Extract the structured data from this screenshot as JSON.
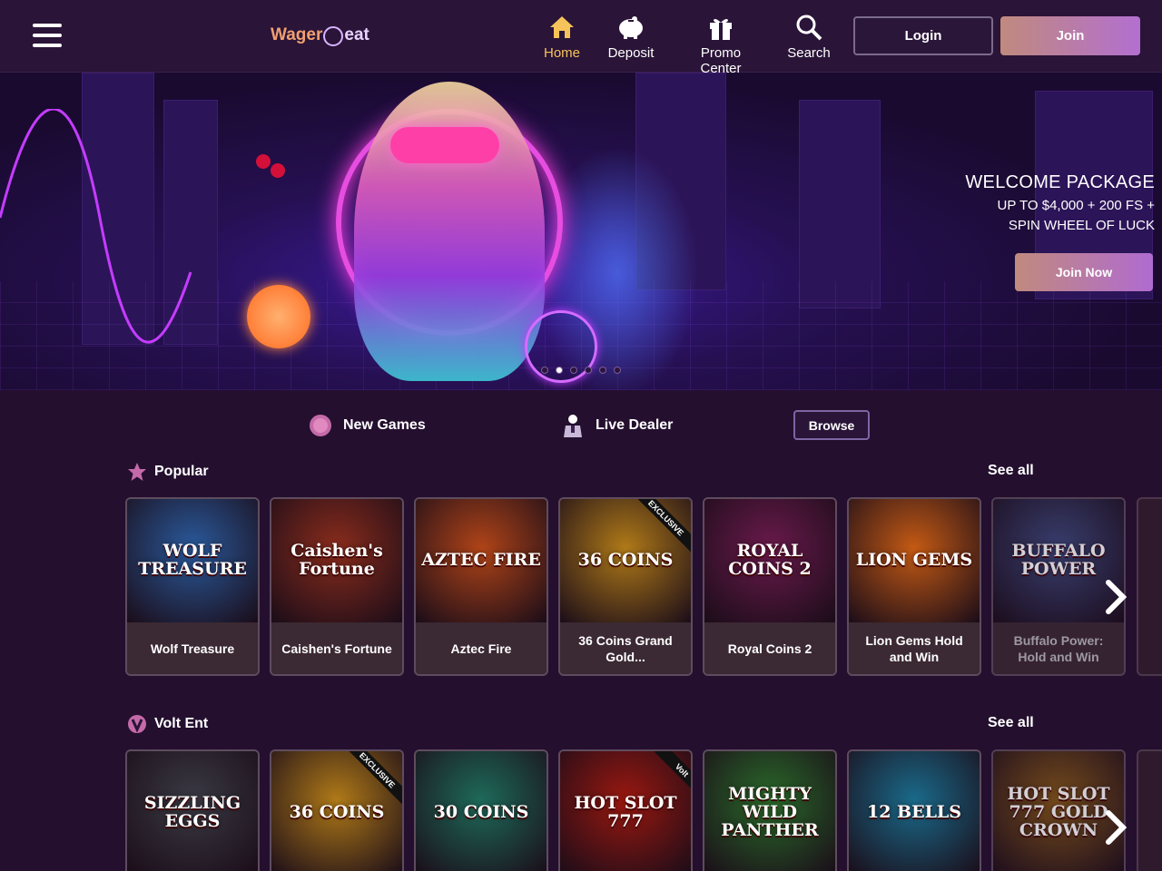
{
  "header": {
    "logo_left": "Wager",
    "logo_right": "eat",
    "nav": [
      {
        "label": "Home",
        "icon": "home-icon",
        "active": true
      },
      {
        "label": "Deposit",
        "icon": "piggy-bank-icon",
        "active": false
      },
      {
        "label": "Promo Center",
        "icon": "gift-icon",
        "active": false
      },
      {
        "label": "Search",
        "icon": "search-icon",
        "active": false
      }
    ],
    "login_label": "Login",
    "join_label": "Join"
  },
  "hero": {
    "title": "WELCOME PACKAGE",
    "line1": "UP TO $4,000 + 200 FS +",
    "line2": "SPIN WHEEL OF LUCK",
    "cta_label": "Join Now",
    "slides": 6,
    "active_slide": 2
  },
  "categories": {
    "new_games": "New Games",
    "live_dealer": "Live Dealer",
    "browse": "Browse"
  },
  "popular": {
    "title": "Popular",
    "see_all": "See all",
    "games": [
      {
        "art": "WOLF TREASURE",
        "name": "Wolf Treasure",
        "bg": "#2a5a9c"
      },
      {
        "art": "Caishen's Fortune",
        "name": "Caishen's Fortune",
        "bg": "#8a2c1c"
      },
      {
        "art": "AZTEC FIRE",
        "name": "Aztec Fire",
        "bg": "#b04418"
      },
      {
        "art": "36 COINS",
        "name": "36 Coins Grand Gold...",
        "bg": "#b07a18",
        "ribbon": "EXCLUSIVE"
      },
      {
        "art": "ROYAL COINS 2",
        "name": "Royal Coins 2",
        "bg": "#6a1a4c"
      },
      {
        "art": "LION GEMS",
        "name": "Lion Gems Hold and Win",
        "bg": "#c45a14"
      },
      {
        "art": "BUFFALO POWER",
        "name": "Buffalo Power: Hold and Win",
        "bg": "#3e4a7e"
      }
    ]
  },
  "volt": {
    "title": "Volt Ent",
    "see_all": "See all",
    "games": [
      {
        "art": "SIZZLING EGGS",
        "bg": "#3a3a44"
      },
      {
        "art": "36 COINS",
        "bg": "#b07a18",
        "ribbon": "EXCLUSIVE"
      },
      {
        "art": "30 COINS",
        "bg": "#1e6a5a"
      },
      {
        "art": "HOT SLOT 777",
        "bg": "#9a1810",
        "ribbon": "Volt"
      },
      {
        "art": "MIGHTY WILD PANTHER",
        "bg": "#2a6a2a"
      },
      {
        "art": "12 BELLS",
        "bg": "#1a6a8a"
      },
      {
        "art": "HOT SLOT 777 GOLD CROWN",
        "bg": "#8a5a18"
      }
    ]
  }
}
